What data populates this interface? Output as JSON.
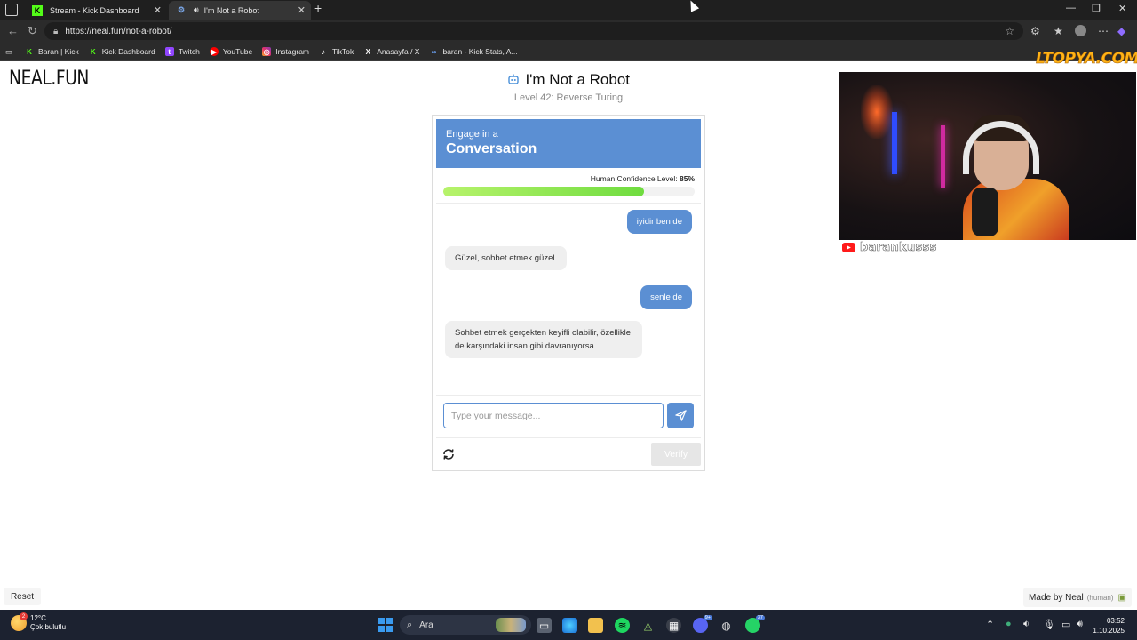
{
  "browser": {
    "tabs": [
      {
        "label": "Stream - Kick Dashboard",
        "favicon": "kick-icon",
        "active": false
      },
      {
        "label": "I'm Not a Robot",
        "favicon": "robot-icon",
        "active": true
      }
    ],
    "address": "https://neal.fun/not-a-robot/",
    "bookmarks": [
      {
        "label": "Baran | Kick",
        "icon": "kick-icon"
      },
      {
        "label": "Kick Dashboard",
        "icon": "kick-icon"
      },
      {
        "label": "Twitch",
        "icon": "twitch-icon"
      },
      {
        "label": "YouTube",
        "icon": "youtube-icon"
      },
      {
        "label": "Instagram",
        "icon": "instagram-icon"
      },
      {
        "label": "TikTok",
        "icon": "tiktok-icon"
      },
      {
        "label": "Anasayfa / X",
        "icon": "x-icon"
      },
      {
        "label": "baran - Kick Stats, A...",
        "icon": "stats-icon"
      }
    ]
  },
  "page": {
    "logo": "NEAL.FUN",
    "title": "I'm Not a Robot",
    "subtitle": "Level 42: Reverse Turing",
    "card": {
      "header_small": "Engage in a",
      "header_big": "Conversation",
      "confidence_label": "Human Confidence Level:",
      "confidence_value": "85%",
      "confidence_fraction": 0.8,
      "messages": [
        {
          "role": "user",
          "text": "iyidir ben de"
        },
        {
          "role": "bot",
          "text": "Güzel, sohbet etmek güzel."
        },
        {
          "role": "user",
          "text": "senle de"
        },
        {
          "role": "bot",
          "text": "Sohbet etmek gerçekten keyifli olabilir, özellikle de karşındaki insan gibi davranıyorsa."
        }
      ],
      "input_placeholder": "Type your message...",
      "verify_label": "Verify"
    },
    "reset_label": "Reset",
    "made_by": "Made by Neal",
    "made_by_suffix": "(human)"
  },
  "overlay": {
    "watermark": "LTOPYA.COM",
    "channel_name": "barankusss"
  },
  "taskbar": {
    "weather_temp": "12°C",
    "weather_desc": "Çok bulutlu",
    "weather_badge": "2",
    "search_placeholder": "Ara",
    "discord_badge": "9+",
    "whatsapp_badge": "37",
    "time": "03:52",
    "date": "1.10.2025"
  },
  "colors": {
    "accent": "#5b8fd3",
    "confidence_fill": "#6fdc3f",
    "browser_dark": "#1f1f1f",
    "taskbar": "#1c2230"
  }
}
